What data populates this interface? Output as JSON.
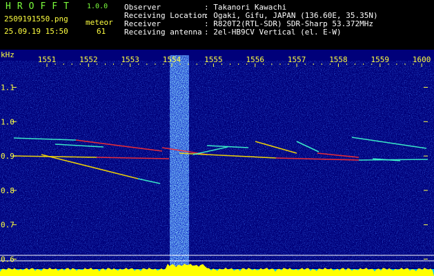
{
  "app": {
    "logo": "HROFFT",
    "version": "1.0.0"
  },
  "file": {
    "name": "2509191550.png",
    "datetime": "25.09.19 15:50"
  },
  "meteor": {
    "label": "meteor",
    "count": "61"
  },
  "info": [
    {
      "key": "Observer",
      "value": ": Takanori Kawachi"
    },
    {
      "key": "Receiving Location",
      "value": ": Ogaki, Gifu, JAPAN (136.60E, 35.35N)"
    },
    {
      "key": "Receiver",
      "value": ": R820T2(RTL-SDR) SDR-Sharp 53.372MHz"
    },
    {
      "key": "Receiving antenna",
      "value": ": 2el-HB9CV Vertical (el. E-W)"
    }
  ],
  "chart_data": {
    "type": "heatmap",
    "yunit": "kHz",
    "x_ticks": [
      "1551",
      "1552",
      "1553",
      "1554",
      "1555",
      "1556",
      "1557",
      "1558",
      "1559",
      "1600"
    ],
    "y_ticks": [
      "1.1",
      "1.0",
      "0.9",
      "0.8",
      "0.7",
      "0.6"
    ],
    "ylim": [
      0.58,
      1.17
    ],
    "colors": {
      "background": "#00007a",
      "noise": "#1a3cff",
      "echo_hot": "#ff3030",
      "echo_warm": "#ffe000",
      "echo_cool": "#40ffd0",
      "level": "#ffff00",
      "level_base": "#00c8ff"
    }
  }
}
